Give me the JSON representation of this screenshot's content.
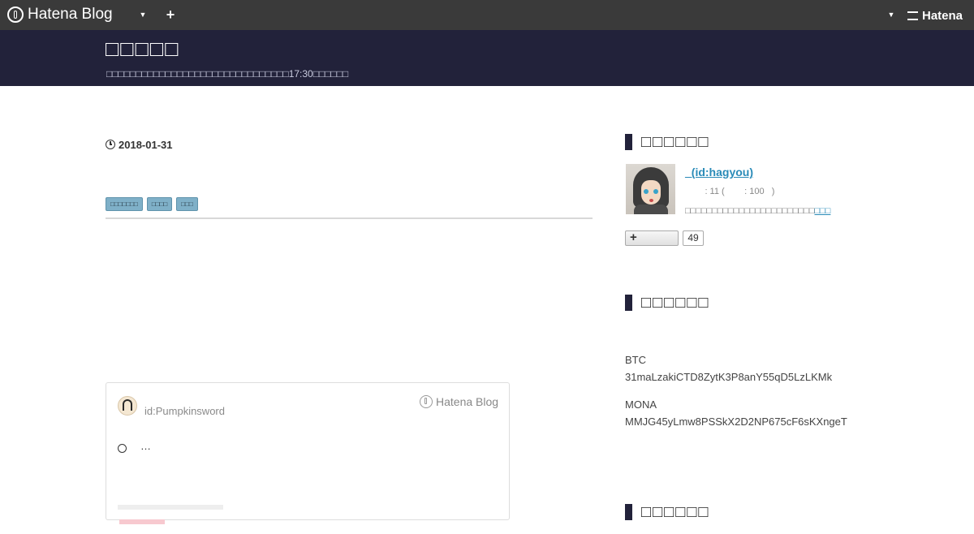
{
  "topbar": {
    "logo_text": "Hatena Blog",
    "dropdown_glyph": "▼",
    "add_glyph": "+",
    "right_dropdown_glyph": "▼",
    "hatena_text": "Hatena"
  },
  "header": {
    "title": "□□□□□",
    "description": "□□□□□□□□□□□□□□□□□□□□□□□□□□□□□□□17:30□□□□□□"
  },
  "entry": {
    "date": "2018-01-31",
    "categories": [
      "□□□□□□□",
      "□□□□",
      "□□□"
    ]
  },
  "embed": {
    "user": "id:Pumpkinsword",
    "brand": "Hatena Blog",
    "ellipsis": "…"
  },
  "sidebar": {
    "profile_title": "□□□□□□",
    "profile_name": "_(id:hagyou)",
    "profile_stats": "        : 11 (        : 100   )",
    "profile_bio": "□□□□□□□□□□□□□□□□□□□□□□□□",
    "profile_bio_link": "□□□",
    "follow_glyph": "+",
    "follow_count": "49",
    "donation_title": "□□□□□□",
    "btc_label": "BTC",
    "btc_address": "31maLzakiCTD8ZytK3P8anY55qD5LzLKMk",
    "mona_label": "MONA",
    "mona_address": "MMJG45yLmw8PSSkX2D2NP675cF6sKXngeT",
    "next_title": "□□□□□□"
  },
  "colors": {
    "topbar": "#3a3a3a",
    "header": "#22223a",
    "link": "#2a8bb8",
    "category": "#7fb0c8"
  }
}
